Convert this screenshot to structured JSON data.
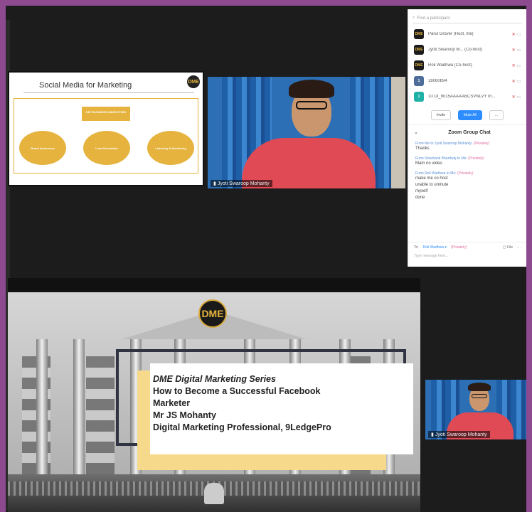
{
  "colors": {
    "accent_gold": "#e5b33e",
    "zoom_blue": "#2d8cff",
    "private_pink": "#e06aa0",
    "muted_red": "#d33333"
  },
  "shared_slide": {
    "title": "Social Media for Marketing",
    "logo": "DME",
    "objective_label": "KEY BUSINESS OBJECTIVES",
    "ovals": [
      "Brand Awareness",
      "Lead Generation",
      "Listening & Monitoring"
    ]
  },
  "video_top": {
    "name": "Jyoti Swaroop Mohanty",
    "signal_icon": "signal-bars-icon"
  },
  "participants": {
    "search_placeholder": "Find a participant",
    "list": [
      {
        "avatar": "DME",
        "avatar_bg": "#1c1c1c",
        "avatar_fg": "#e5b33e",
        "name": "Parul Grover (Host, me)"
      },
      {
        "avatar": "DME",
        "avatar_bg": "#1c1c1c",
        "avatar_fg": "#e5b33e",
        "name": "Jyoti Swaroop M... (Co-host)"
      },
      {
        "avatar": "DME",
        "avatar_bg": "#1c1c1c",
        "avatar_fg": "#e5b33e",
        "name": "Roli Wadhwa (Co-host)"
      },
      {
        "avatar": "1",
        "avatar_bg": "#4d6d9a",
        "avatar_fg": "#ffffff",
        "name": "1b0b0b94"
      },
      {
        "avatar": "1",
        "avatar_bg": "#1fb0a6",
        "avatar_fg": "#ffffff",
        "name": "1iTOl_9015AAAAABCSVNLVYTh..."
      }
    ],
    "invite_label": "Invite",
    "mute_all_label": "Mute All",
    "more_label": "..."
  },
  "chat": {
    "title": "Zoom Group Chat",
    "messages": [
      {
        "from": "From Me to Jyoti Swaroop Mohanty:",
        "privacy": "(Privately)",
        "lines": [
          "Thanks"
        ]
      },
      {
        "from": "From Shashank Bhardwaj to Me:",
        "privacy": "(Privately)",
        "lines": [
          "Mam no video"
        ]
      },
      {
        "from": "From Roli Wadhwa to Me:",
        "privacy": "(Privately)",
        "lines": [
          "make me co host",
          "unable to unmute",
          "myself",
          "done"
        ]
      }
    ],
    "to_label": "To:",
    "recipient": "Roli Wadhwa ▾",
    "recipient_privacy": "(Privately)",
    "file_label": "File",
    "input_placeholder": "Type message here..."
  },
  "main_slide": {
    "logo": "DME",
    "lines": [
      "DME Digital Marketing Series",
      "How to Become a Successful Facebook",
      "Marketer",
      "Mr JS Mohanty",
      "Digital Marketing Professional, 9LedgePro"
    ]
  },
  "video_bottom": {
    "name": "Jyoti Swaroop Mohanty"
  }
}
